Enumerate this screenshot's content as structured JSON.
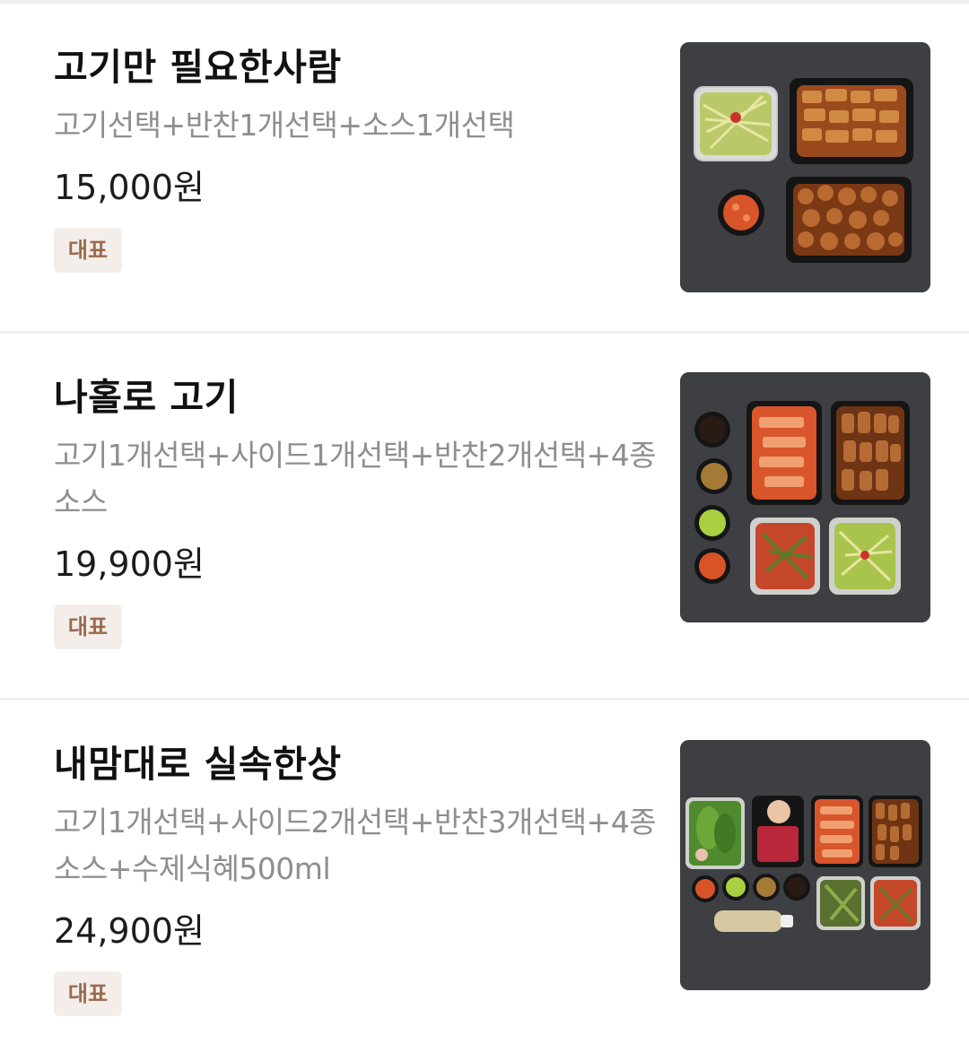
{
  "menu_items": [
    {
      "name": "고기만 필요한사람",
      "description": "고기선택+반찬1개선택+소스1개선택",
      "price": "15,000원",
      "badge": "대표",
      "image_icon": "food-photo"
    },
    {
      "name": "나홀로 고기",
      "description": "고기1개선택+사이드1개선택+반찬2개선택+4종소스",
      "price": "19,900원",
      "badge": "대표",
      "image_icon": "food-photo"
    },
    {
      "name": "내맘대로 실속한상",
      "description": "고기1개선택+사이드2개선택+반찬3개선택+4종소스+수제식혜500ml",
      "price": "24,900원",
      "badge": "대표",
      "image_icon": "food-photo"
    }
  ],
  "colors": {
    "name_text": "#111111",
    "description_text": "#8e8e8e",
    "price_text": "#1c1c1c",
    "badge_bg": "#f4eeea",
    "badge_text": "#9a6a4e",
    "photo_bg": "#3c3d41"
  }
}
